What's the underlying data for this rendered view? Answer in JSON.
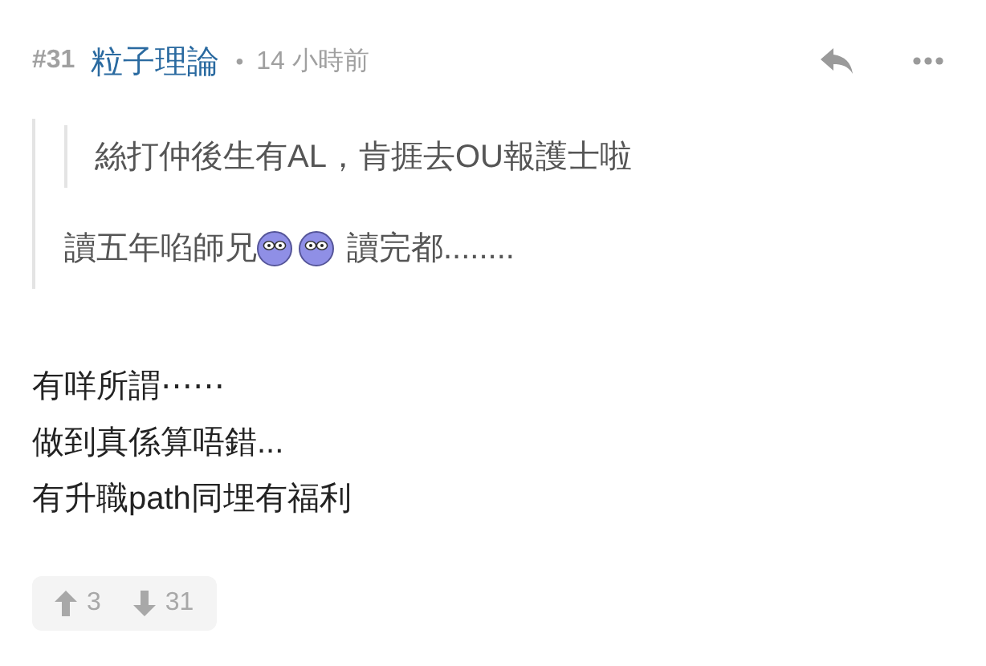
{
  "post": {
    "number": "#31",
    "author": "粒子理論",
    "separator": "•",
    "time": "14 小時前"
  },
  "quote": {
    "nested_quote": "絲打仲後生有AL，肯捱去OU報護士啦",
    "parts": [
      {
        "kind": "text",
        "text": "讀五年啗師兄"
      },
      {
        "kind": "emoticon"
      },
      {
        "kind": "emoticon"
      },
      {
        "kind": "text",
        "text": "讀完都........"
      }
    ]
  },
  "body": [
    "有咩所謂⋯⋯",
    "做到真係算唔錯...",
    "有升職path同埋有福利"
  ],
  "votes": {
    "up": "3",
    "down": "31"
  }
}
